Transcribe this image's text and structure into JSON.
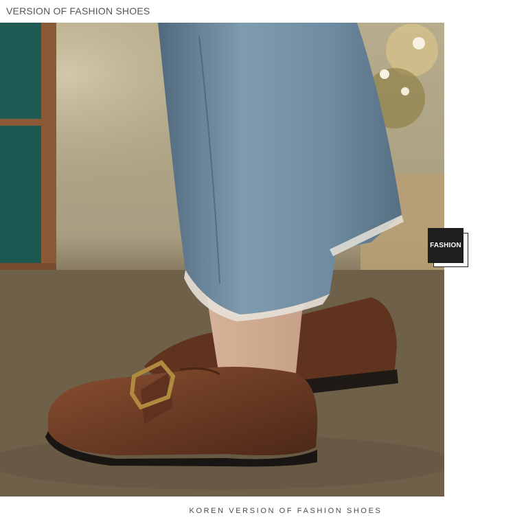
{
  "header": {
    "title": "VERSION OF FASHION SHOES"
  },
  "badge": {
    "label": "FASHION"
  },
  "footer": {
    "caption": "KOREN VERSION OF FASHION SHOES"
  },
  "colors": {
    "background": "#ffffff",
    "badge_bg": "#1e1e1e",
    "shoe_brown": "#6b3b24",
    "denim": "#6f8ca2",
    "carpet": "#6f6049"
  },
  "icons": {
    "hero": "product-photo-loafers"
  }
}
